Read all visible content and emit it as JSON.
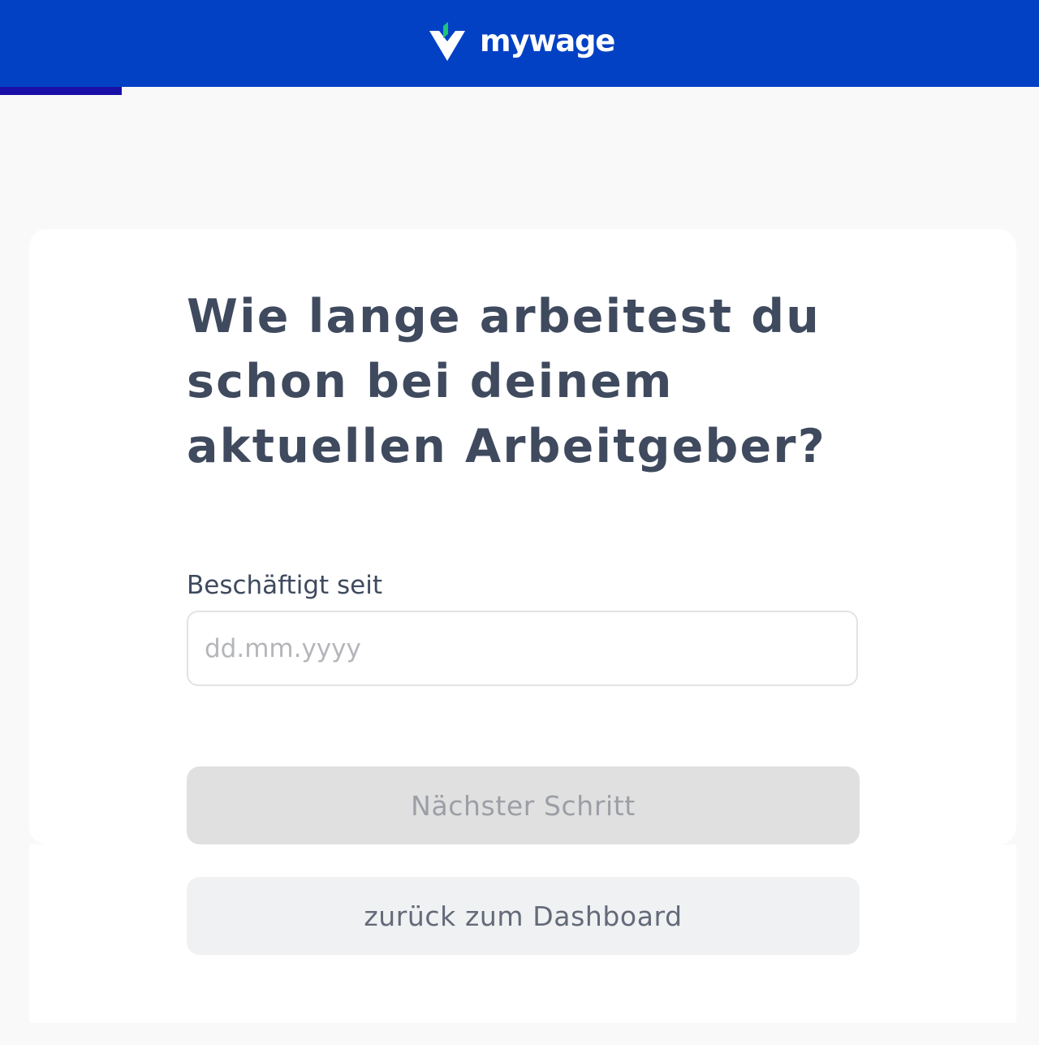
{
  "header": {
    "brand_name": "mywage",
    "logo_icon": "mywage-leaf-logo-icon",
    "background_color": "#0341c4",
    "logo_accent_color": "#1fc279"
  },
  "progress": {
    "fraction": 0.117,
    "color": "#1a10a8"
  },
  "question": {
    "title": "Wie lange arbeitest du schon bei deinem aktuellen Arbeitgeber?"
  },
  "form": {
    "employed_since_label": "Beschäftigt seit",
    "employed_since_placeholder": "dd.mm.yyyy",
    "employed_since_value": ""
  },
  "actions": {
    "next_label": "Nächster Schritt",
    "back_label": "zurück zum Dashboard"
  }
}
